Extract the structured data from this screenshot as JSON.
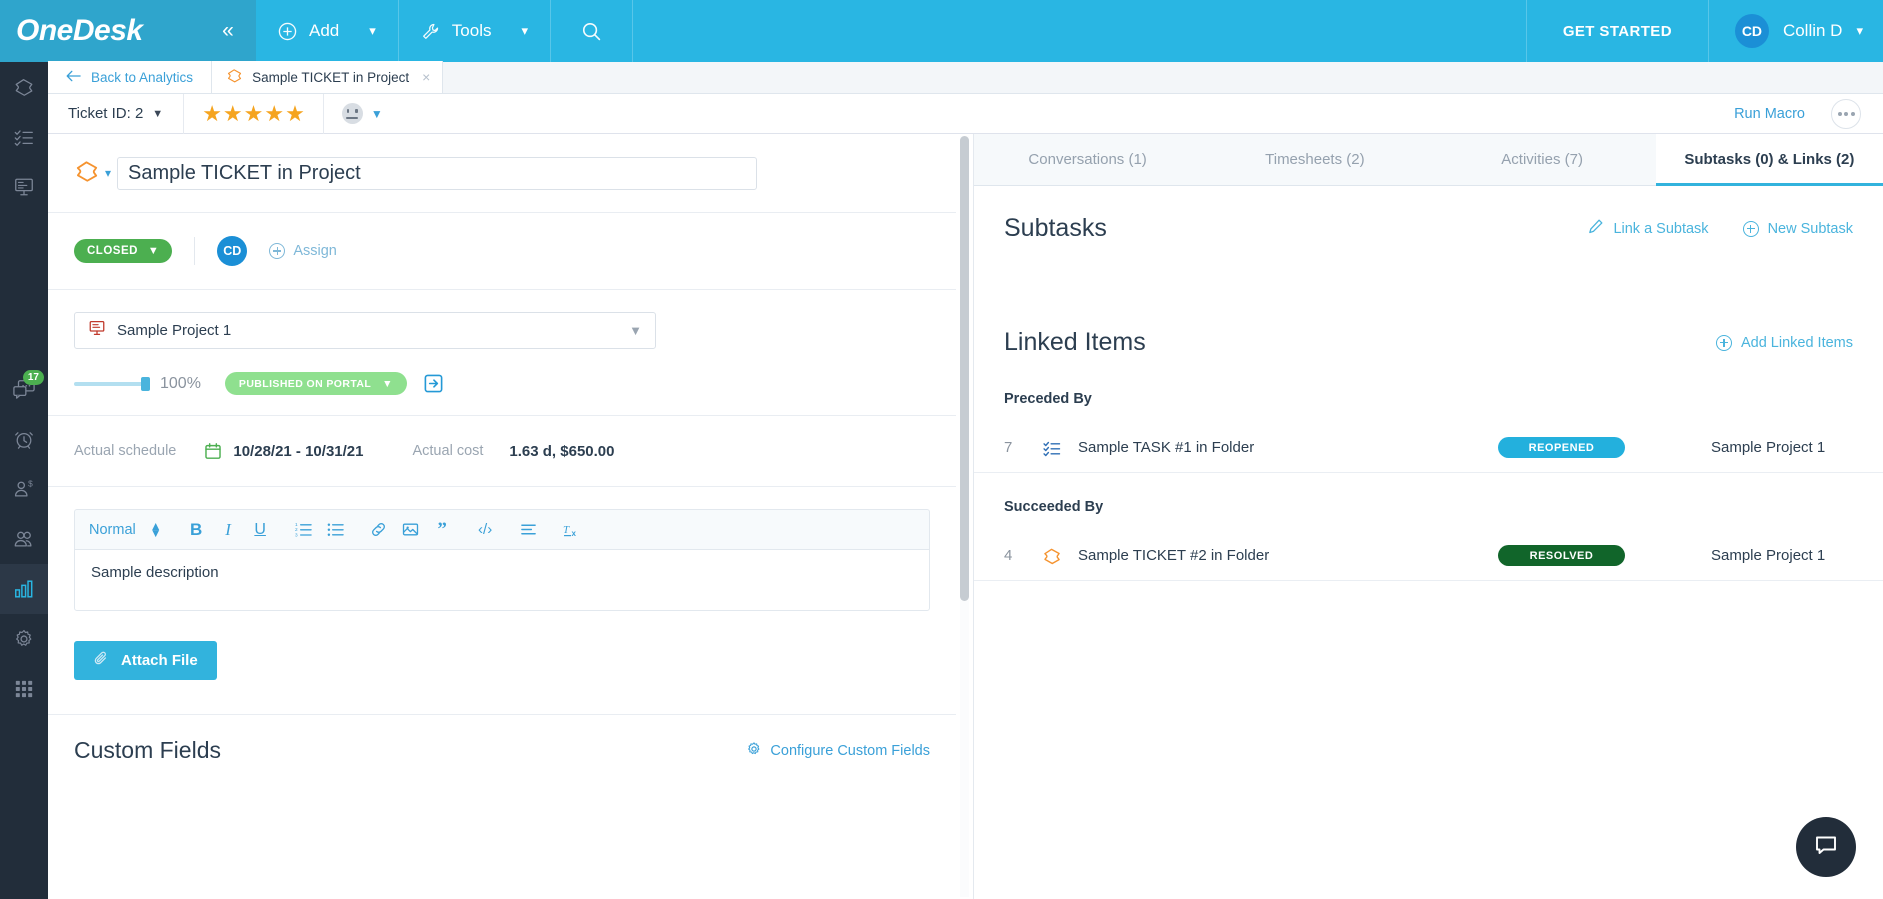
{
  "topbar": {
    "brand": "OneDesk",
    "collapse_icon": "double-chevron-left-icon",
    "add_label": "Add",
    "tools_label": "Tools",
    "search_icon": "search-icon",
    "get_started_label": "GET STARTED",
    "avatar_initials": "CD",
    "user_name": "Collin D"
  },
  "rail": {
    "items": [
      {
        "name": "tickets",
        "icon": "ticket-icon",
        "badge": ""
      },
      {
        "name": "tasks",
        "icon": "checklist-icon",
        "badge": ""
      },
      {
        "name": "projects",
        "icon": "project-board-icon",
        "badge": ""
      },
      {
        "name": "messages",
        "icon": "chat-bubbles-icon",
        "badge": "17"
      },
      {
        "name": "timesheets",
        "icon": "alarm-clock-icon",
        "badge": ""
      },
      {
        "name": "customers",
        "icon": "customer-dollar-icon",
        "badge": ""
      },
      {
        "name": "users",
        "icon": "users-icon",
        "badge": ""
      },
      {
        "name": "analytics",
        "icon": "bar-chart-icon",
        "badge": ""
      },
      {
        "name": "settings",
        "icon": "gear-icon",
        "badge": ""
      },
      {
        "name": "apps",
        "icon": "grid-apps-icon",
        "badge": ""
      }
    ]
  },
  "tabstrip": {
    "back_label": "Back to Analytics",
    "back_icon": "arrow-left-icon",
    "doc_tab_label": "Sample TICKET in Project",
    "doc_tab_icon": "ticket-icon",
    "doc_tab_close": "×"
  },
  "subheader": {
    "ticket_id_label": "Ticket ID: 2",
    "stars_filled": 5,
    "star_glyph": "★",
    "mood_icon": "neutral-face-icon",
    "run_macro_label": "Run Macro",
    "more_icon": "ellipsis-icon"
  },
  "detail": {
    "type_icon": "ticket-icon",
    "title_value": "Sample TICKET in Project",
    "title_placeholder": "Enter item name",
    "status_pill": "CLOSED",
    "status_color": "#4caf50",
    "assignee_initials": "CD",
    "assign_label": "Assign",
    "project_name": "Sample Project 1",
    "project_icon": "project-board-icon",
    "progress_percent": "100%",
    "progress_value": 100,
    "portal_pill": "PUBLISHED ON PORTAL",
    "portal_color": "#8fe08f",
    "portal_open_icon": "open-external-icon",
    "schedule_label": "Actual schedule",
    "schedule_value": "10/28/21 - 10/31/21",
    "calendar_icon": "calendar-icon",
    "cost_label": "Actual cost",
    "cost_value": "1.63 d, $650.00",
    "editor": {
      "style_label": "Normal",
      "buttons": [
        {
          "name": "bold-button",
          "glyph": "B"
        },
        {
          "name": "italic-button",
          "glyph": "I"
        },
        {
          "name": "underline-button",
          "glyph": "U"
        },
        {
          "name": "ordered-list-button",
          "glyph": "list-ol-icon"
        },
        {
          "name": "bullet-list-button",
          "glyph": "list-ul-icon"
        },
        {
          "name": "link-button",
          "glyph": "link-icon"
        },
        {
          "name": "image-button",
          "glyph": "image-icon"
        },
        {
          "name": "quote-button",
          "glyph": "quote-icon"
        },
        {
          "name": "code-button",
          "glyph": "code-icon"
        },
        {
          "name": "align-button",
          "glyph": "align-icon"
        },
        {
          "name": "clear-format-button",
          "glyph": "clear-format-icon"
        }
      ],
      "description": "Sample description"
    },
    "attach_label": "Attach File",
    "attach_icon": "paperclip-icon",
    "custom_fields_title": "Custom Fields",
    "configure_cf_label": "Configure Custom Fields",
    "configure_cf_icon": "gear-icon"
  },
  "right": {
    "tabs": [
      {
        "label": "Conversations (1)",
        "active": false
      },
      {
        "label": "Timesheets (2)",
        "active": false
      },
      {
        "label": "Activities (7)",
        "active": false
      },
      {
        "label": "Subtasks (0) & Links (2)",
        "active": true
      }
    ],
    "subtasks": {
      "title": "Subtasks",
      "link_subtask_label": "Link a Subtask",
      "link_subtask_icon": "pencil-link-icon",
      "new_subtask_label": "New Subtask",
      "new_subtask_icon": "plus-circle-icon"
    },
    "linked_items": {
      "title": "Linked Items",
      "add_label": "Add Linked Items",
      "add_icon": "plus-circle-icon",
      "groups": [
        {
          "group_label": "Preceded By",
          "rows": [
            {
              "number": "7",
              "icon": "checklist-icon",
              "name": "Sample TASK #1 in Folder",
              "status": "REOPENED",
              "status_color": "#23b0dd",
              "project": "Sample Project 1"
            }
          ]
        },
        {
          "group_label": "Succeeded By",
          "rows": [
            {
              "number": "4",
              "icon": "ticket-icon",
              "name": "Sample TICKET #2 in Folder",
              "status": "RESOLVED",
              "status_color": "#11652a",
              "project": "Sample Project 1"
            }
          ]
        }
      ]
    },
    "chat_fab_icon": "chat-bubble-icon"
  }
}
